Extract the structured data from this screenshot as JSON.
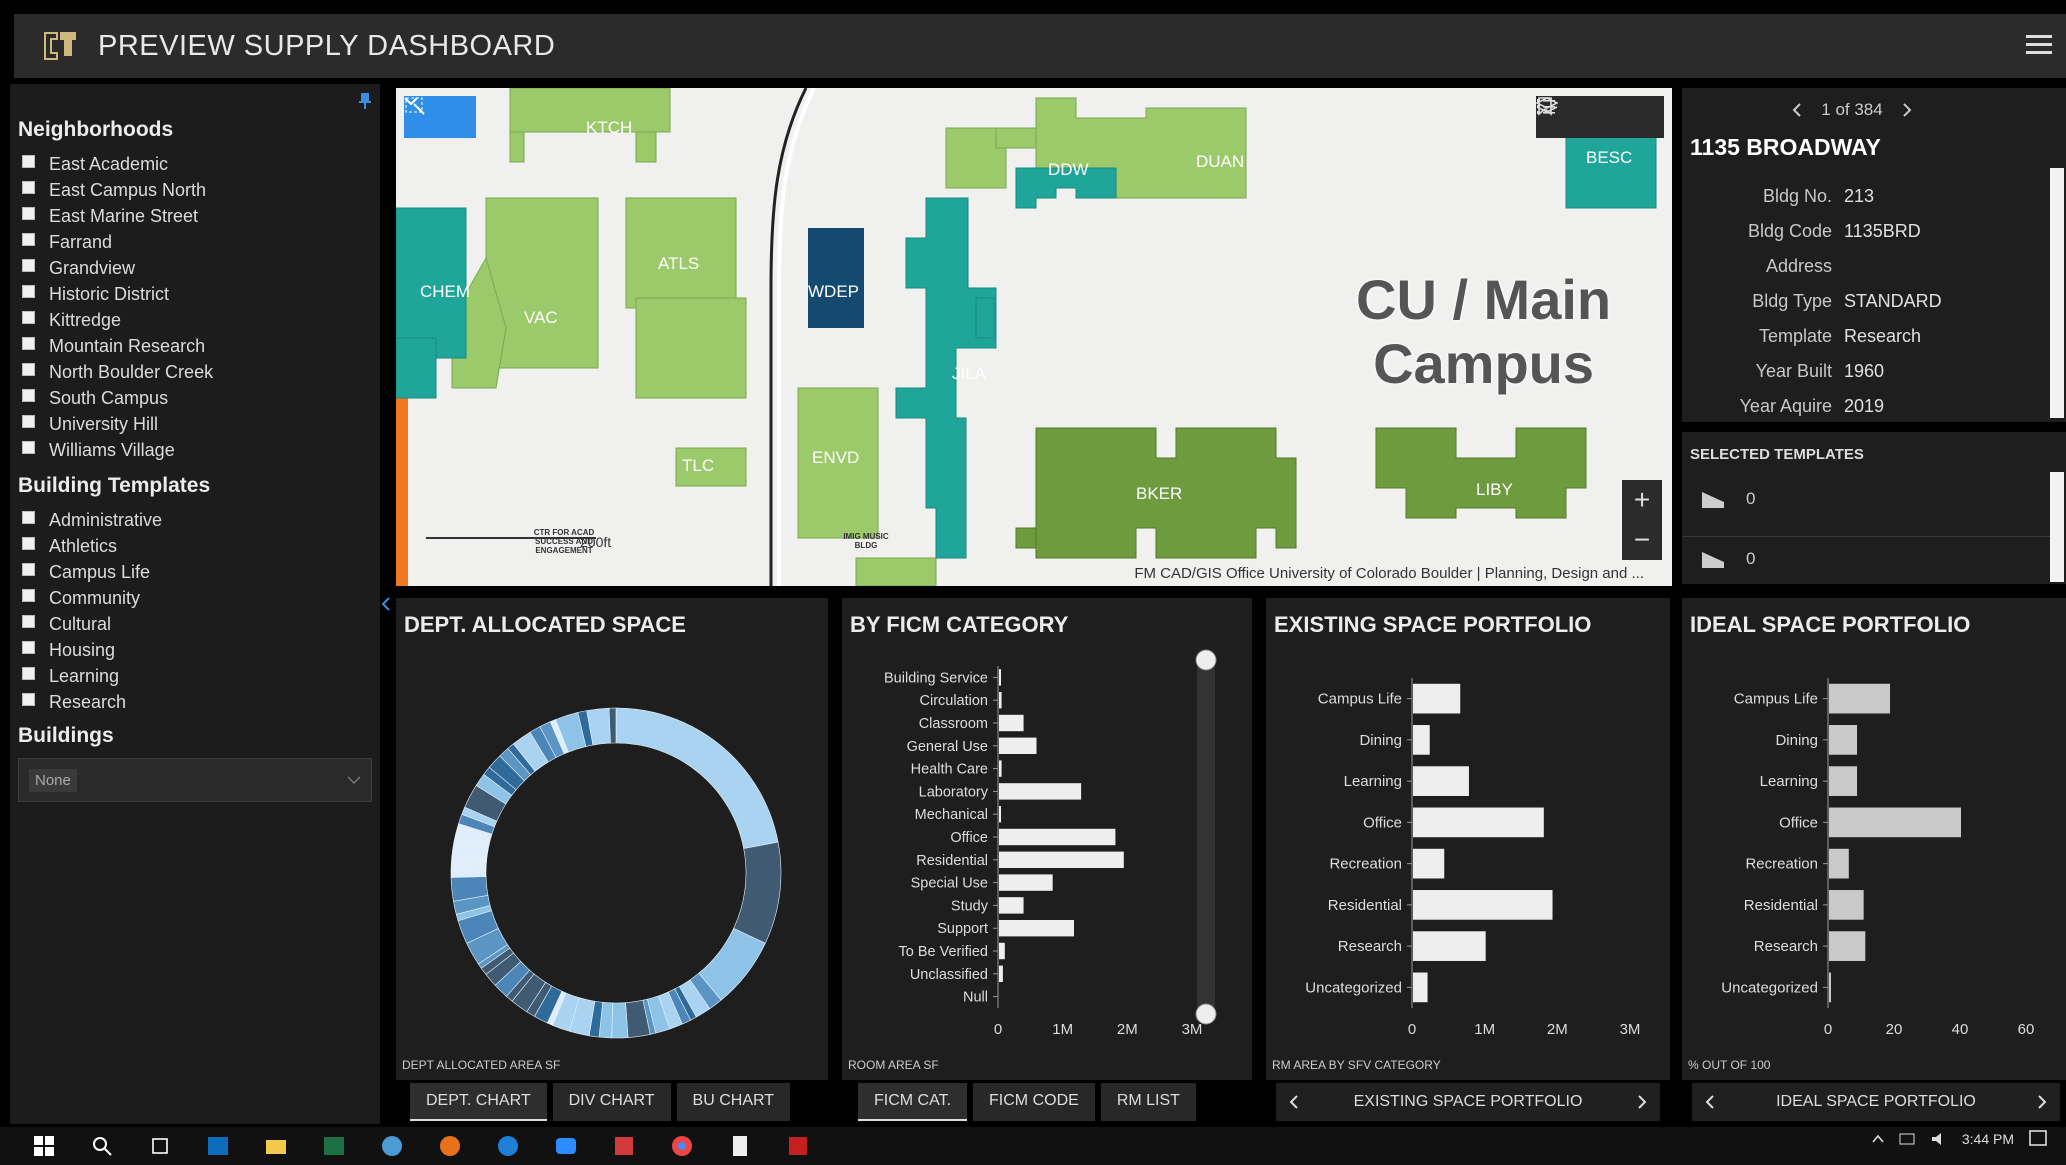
{
  "header": {
    "title": "PREVIEW SUPPLY DASHBOARD"
  },
  "left_panel": {
    "neighborhoods_title": "Neighborhoods",
    "neighborhoods": [
      "East Academic",
      "East Campus North",
      "East Marine Street",
      "Farrand",
      "Grandview",
      "Historic District",
      "Kittredge",
      "Mountain Research",
      "North Boulder Creek",
      "South Campus",
      "University Hill",
      "Williams Village"
    ],
    "templates_title": "Building Templates",
    "templates": [
      "Administrative",
      "Athletics",
      "Campus Life",
      "Community",
      "Cultural",
      "Housing",
      "Learning",
      "Research"
    ],
    "buildings_title": "Buildings",
    "buildings_value": "None"
  },
  "map": {
    "buildings": [
      "KTCH",
      "DDW",
      "DUAN",
      "BESC",
      "CHEM",
      "VAC",
      "ATLS",
      "WDEP",
      "JILA",
      "TLC",
      "ENVD",
      "BKER",
      "LIBY"
    ],
    "campus_label_line1": "CU / Main",
    "campus_label_line2": "Campus",
    "scale_label": "200ft",
    "small_labels": [
      "CTR FOR ACAD SUCCESS AND ENGAGEMENT",
      "IMIG MUSIC BLDG"
    ],
    "attribution": "FM CAD/GIS Office University of Colorado Boulder | Planning, Design and ...",
    "zoom_in": "+",
    "zoom_out": "−"
  },
  "info": {
    "pager": "1 of 384",
    "title": "1135 BROADWAY",
    "rows": [
      {
        "k": "Bldg No.",
        "v": "213"
      },
      {
        "k": "Bldg Code",
        "v": "1135BRD"
      },
      {
        "k": "Address",
        "v": ""
      },
      {
        "k": "Bldg Type",
        "v": "STANDARD"
      },
      {
        "k": "Template",
        "v": "Research"
      },
      {
        "k": "Year Built",
        "v": "1960"
      },
      {
        "k": "Year Aquire",
        "v": "2019"
      }
    ]
  },
  "selected_templates": {
    "title": "SELECTED TEMPLATES",
    "values": [
      "0",
      "0"
    ]
  },
  "panels": {
    "dept": {
      "title": "DEPT. ALLOCATED SPACE",
      "footer": "DEPT ALLOCATED AREA SF",
      "tabs": [
        "DEPT. CHART",
        "DIV CHART",
        "BU CHART"
      ]
    },
    "ficm": {
      "title": "BY FICM CATEGORY",
      "footer": "ROOM AREA SF",
      "tabs": [
        "FICM CAT.",
        "FICM CODE",
        "RM LIST"
      ]
    },
    "existing": {
      "title": "EXISTING SPACE PORTFOLIO",
      "footer": "RM AREA BY SFV CATEGORY",
      "nav": "EXISTING SPACE PORTFOLIO"
    },
    "ideal": {
      "title": "IDEAL SPACE PORTFOLIO",
      "footer": "% OUT OF 100",
      "nav": "IDEAL SPACE PORTFOLIO"
    }
  },
  "chart_data": [
    {
      "type": "pie",
      "title": "DEPT. ALLOCATED SPACE",
      "xlabel": "DEPT ALLOCATED AREA SF",
      "donut": true,
      "colors": [
        "#8ec3e8",
        "#5a95c4",
        "#2e6a9a",
        "#3f5a72",
        "#a9d3f0",
        "#4c86b8",
        "#dfeefa"
      ]
    },
    {
      "type": "bar",
      "orientation": "horizontal",
      "title": "BY FICM CATEGORY",
      "xlabel": "ROOM AREA SF",
      "categories": [
        "Building Service",
        "Circulation",
        "Classroom",
        "General Use",
        "Health Care",
        "Laboratory",
        "Mechanical",
        "Office",
        "Residential",
        "Special Use",
        "Study",
        "Support",
        "To Be Verified",
        "Unclassified",
        "Null"
      ],
      "values": [
        20000,
        40000,
        380000,
        580000,
        40000,
        1270000,
        20000,
        1800000,
        1930000,
        830000,
        380000,
        1160000,
        90000,
        60000,
        0
      ],
      "xlim": [
        0,
        3000000
      ],
      "xticks": [
        "0",
        "1M",
        "2M",
        "3M"
      ]
    },
    {
      "type": "bar",
      "orientation": "horizontal",
      "title": "EXISTING SPACE PORTFOLIO",
      "xlabel": "RM AREA BY SFV CATEGORY",
      "categories": [
        "Campus Life",
        "Dining",
        "Learning",
        "Office",
        "Recreation",
        "Residential",
        "Research",
        "Uncategorized"
      ],
      "values": [
        650000,
        230000,
        770000,
        1800000,
        430000,
        1920000,
        1000000,
        200000
      ],
      "xlim": [
        0,
        3000000
      ],
      "xticks": [
        "0",
        "1M",
        "2M",
        "3M"
      ]
    },
    {
      "type": "bar",
      "orientation": "horizontal",
      "title": "IDEAL SPACE PORTFOLIO",
      "xlabel": "% OUT OF 100",
      "categories": [
        "Campus Life",
        "Dining",
        "Learning",
        "Office",
        "Recreation",
        "Residential",
        "Research",
        "Uncategorized"
      ],
      "values": [
        18.5,
        8.5,
        8.5,
        40,
        6,
        10.5,
        11,
        0.5
      ],
      "xlim": [
        0,
        60
      ],
      "xticks": [
        "0",
        "20",
        "40",
        "60"
      ]
    }
  ],
  "taskbar": {
    "time": "3:44 PM"
  }
}
